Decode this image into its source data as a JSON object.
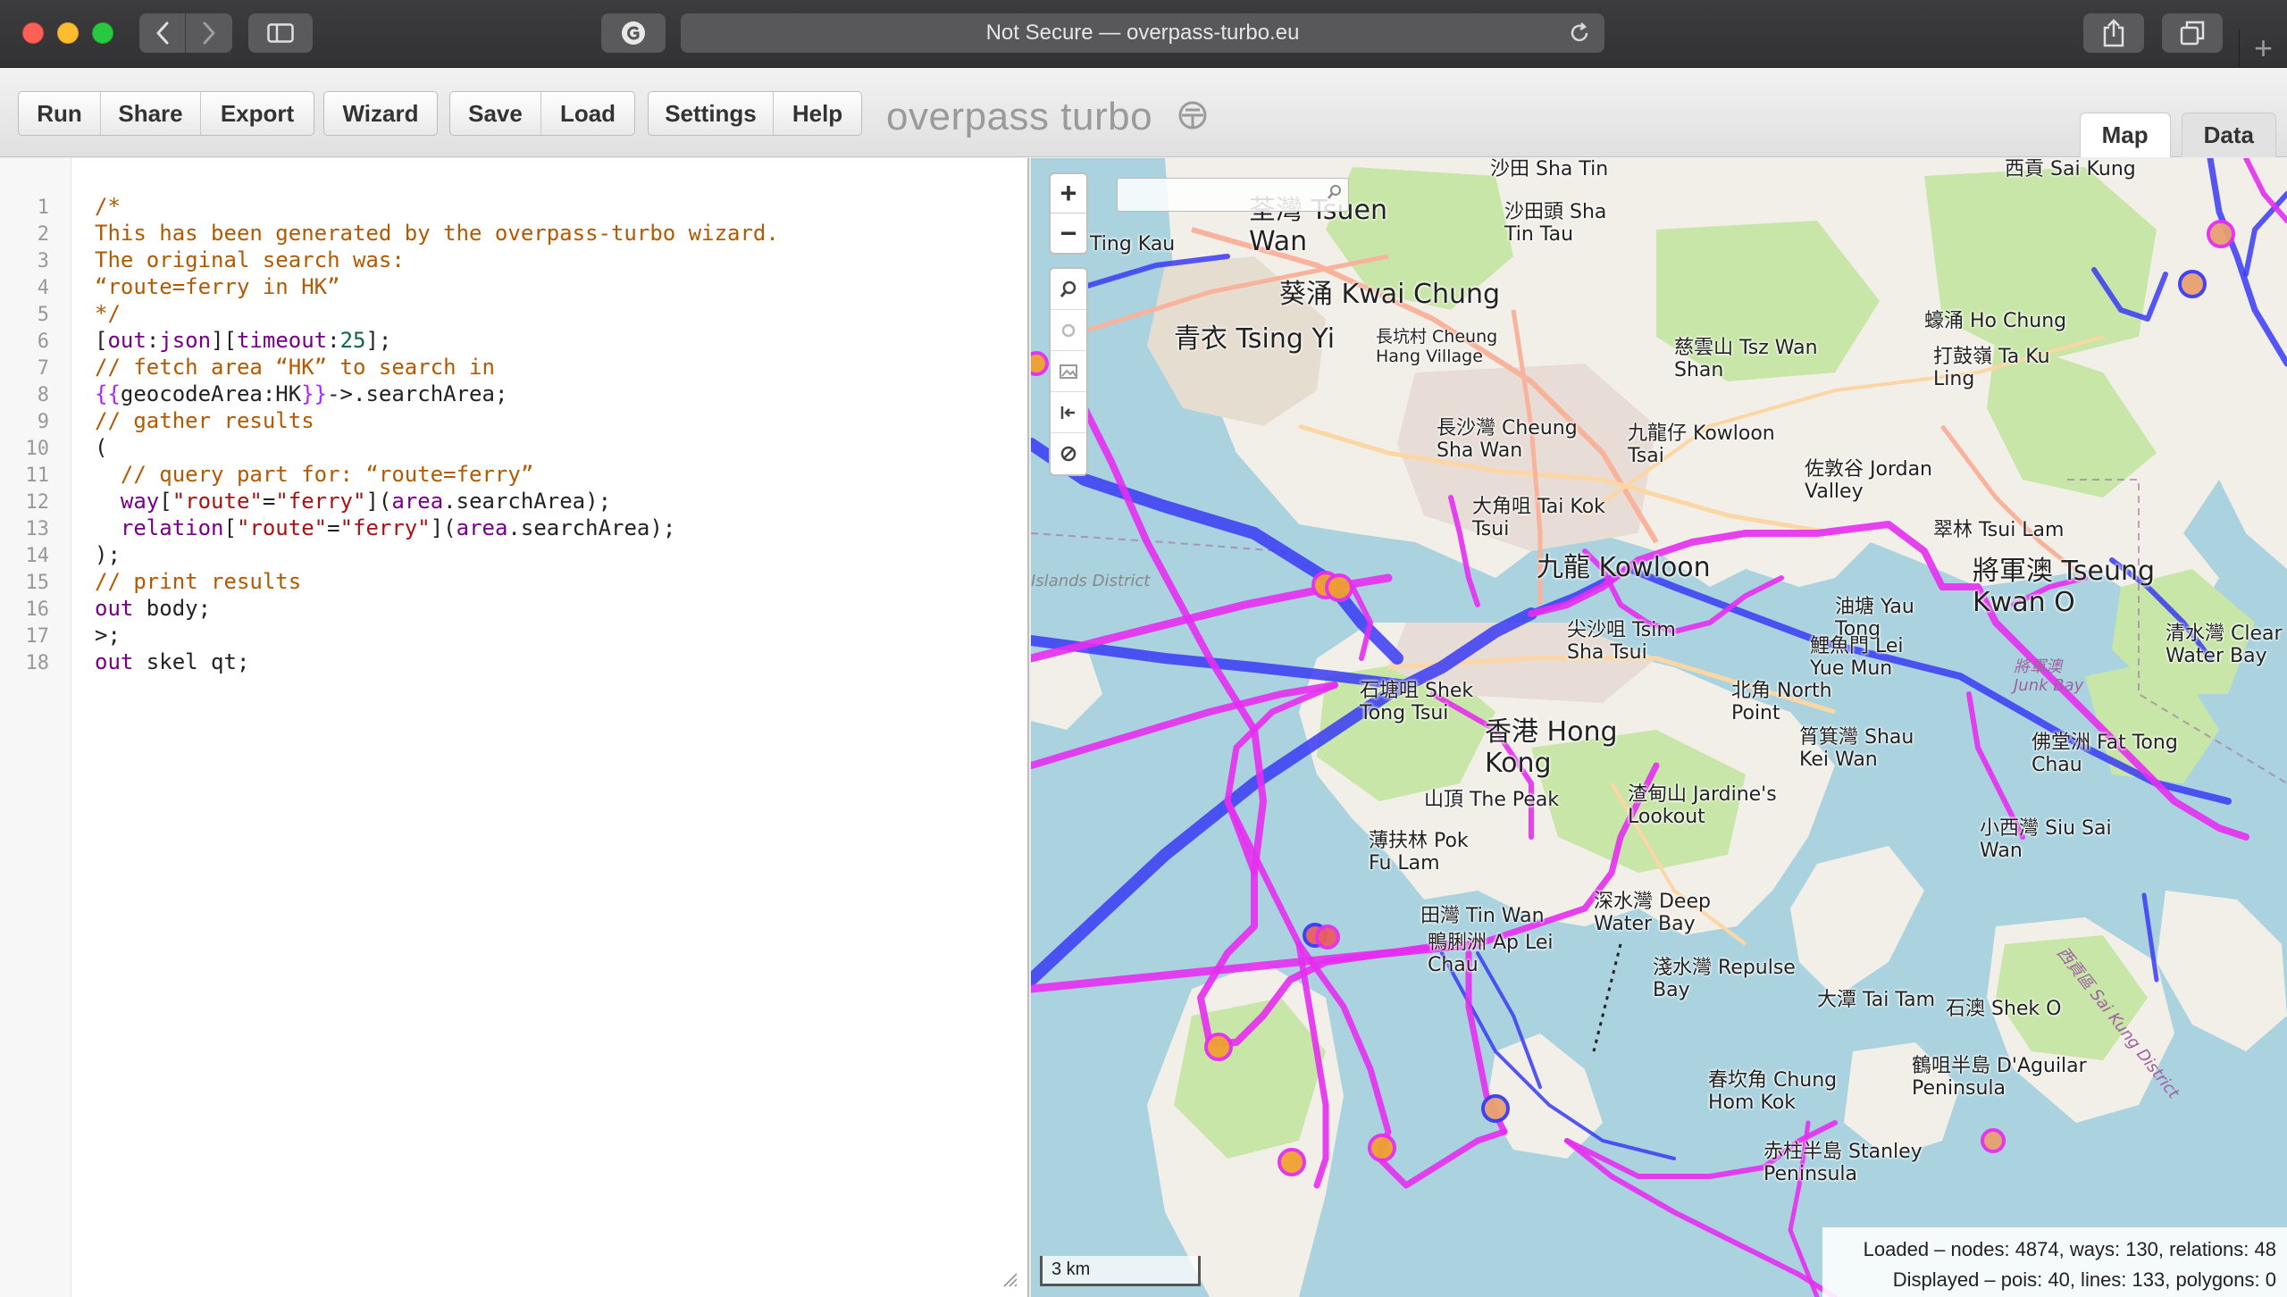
{
  "browser": {
    "address": "Not Secure — overpass-turbo.eu"
  },
  "toolbar": {
    "run": "Run",
    "share": "Share",
    "export": "Export",
    "wizard": "Wizard",
    "save": "Save",
    "load": "Load",
    "settings": "Settings",
    "help": "Help",
    "title": "overpass turbo",
    "tab_map": "Map",
    "tab_data": "Data"
  },
  "editor": {
    "line_numbers": [
      "1",
      "2",
      "3",
      "4",
      "5",
      "6",
      "7",
      "8",
      "9",
      "10",
      "11",
      "12",
      "13",
      "14",
      "15",
      "16",
      "17",
      "18"
    ],
    "lines": {
      "l1": "/*",
      "l2": "This has been generated by the overpass-turbo wizard.",
      "l3": "The original search was:",
      "l4": "“route=ferry in HK”",
      "l5": "*/",
      "l6_a": "[",
      "l6_b": "out",
      "l6_c": ":",
      "l6_d": "json",
      "l6_e": "][",
      "l6_f": "timeout",
      "l6_g": ":",
      "l6_h": "25",
      "l6_i": "];",
      "l7": "// fetch area “HK” to search in",
      "l8_a": "{{",
      "l8_b": "geocodeArea:HK",
      "l8_c": "}}",
      "l8_d": "->.searchArea;",
      "l9": "// gather results",
      "l10": "(",
      "l11": "  // query part for: “route=ferry”",
      "l12_a": "  way",
      "l12_b": "[",
      "l12_c": "\"route\"",
      "l12_d": "=",
      "l12_e": "\"ferry\"",
      "l12_f": "](",
      "l12_g": "area",
      "l12_h": ".searchArea);",
      "l13_a": "  relation",
      "l13_b": "[",
      "l13_c": "\"route\"",
      "l13_d": "=",
      "l13_e": "\"ferry\"",
      "l13_f": "](",
      "l13_g": "area",
      "l13_h": ".searchArea);",
      "l14": ");",
      "l15": "// print results",
      "l16_a": "out",
      "l16_b": " body;",
      "l17": ">;",
      "l18_a": "out",
      "l18_b": " skel qt;"
    }
  },
  "map": {
    "zoom_in": "+",
    "zoom_out": "−",
    "scale": "3 km",
    "stats_loaded": "Loaded – nodes: 4874, ways: 130, relations: 48",
    "stats_displayed": "Displayed – pois: 40, lines: 133, polygons: 0",
    "labels": {
      "sai_kung": "西貢 Sai Kung",
      "sha_tin": "沙田 Sha Tin",
      "tsuen_wan": "荃灣 Tsuen\nWan",
      "ting_kau": "Ting Kau",
      "sha_tin_tau": "沙田頭 Sha\nTin Tau",
      "kwai_chung": "葵涌 Kwai Chung",
      "ho_chung": "蠔涌 Ho Chung",
      "tsing_yi": "青衣 Tsing Yi",
      "cheung_hang": "長坑村 Cheung\nHang Village",
      "tsz_wan_shan": "慈雲山 Tsz Wan\nShan",
      "ta_ku_ling": "打鼓嶺 Ta Ku\nLing",
      "cheung_sha_wan": "長沙灣 Cheung\nSha Wan",
      "kowloon_tsai": "九龍仔 Kowloon\nTsai",
      "jordan_valley": "佐敦谷 Jordan\nValley",
      "tai_kok_tsui": "大角咀 Tai Kok\nTsui",
      "tsui_lam": "翠林 Tsui Lam",
      "kowloon": "九龍 Kowloon",
      "tseung_kwan_o": "將軍澳 Tseung\nKwan O",
      "islands": "Islands District",
      "tsim_sha_tsui": "尖沙咀 Tsim\nSha Tsui",
      "yau_tong": "油塘 Yau\nTong",
      "lei_yue_mun": "鯉魚門 Lei\nYue Mun",
      "clear_water_bay": "清水灣 Clear\nWater Bay",
      "shek_tong_tsui": "石塘咀 Shek\nTong Tsui",
      "north_point": "北角 North\nPoint",
      "junk_bay": "將軍澳\nJunk Bay",
      "hong_kong": "香港 Hong\nKong",
      "shau_kei_wan": "筲箕灣 Shau\nKei Wan",
      "fat_tong_chau": "佛堂洲 Fat Tong\nChau",
      "the_peak": "山頂 The Peak",
      "jardines_lookout": "渣甸山 Jardine's\nLookout",
      "pok_fu_lam": "薄扶林 Pok\nFu Lam",
      "siu_sai_wan": "小西灣 Siu Sai\nWan",
      "tin_wan": "田灣 Tin Wan",
      "ap_lei_chau": "鴨脷洲 Ap Lei\nChau",
      "deep_water_bay": "深水灣 Deep\nWater Bay",
      "repulse_bay": "淺水灣 Repulse\nBay",
      "tai_tam": "大潭 Tai Tam",
      "shek_o": "石澳 Shek O",
      "daguilar": "鶴咀半島 D'Aguilar\nPeninsula",
      "chung_hom_kok": "春坎角 Chung\nHom Kok",
      "stanley": "赤柱半島 Stanley\nPeninsula",
      "sai_kung_district": "西貢區 Sai Kung District"
    }
  },
  "colors": {
    "ferry_relation": "#e62ef0",
    "ferry_way": "#3a3af5",
    "map_water": "#aad3df",
    "map_land": "#f2efe9",
    "map_park": "#c8e6a8"
  }
}
